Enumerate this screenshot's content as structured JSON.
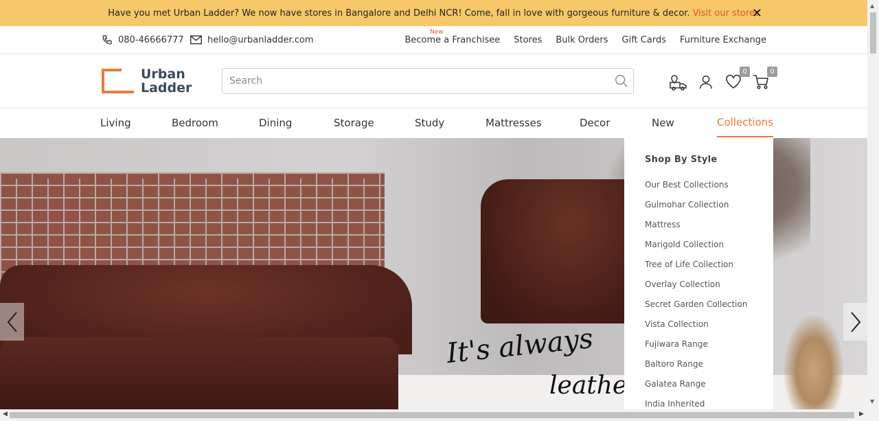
{
  "announcement": {
    "text": "Have you met Urban Ladder? We now have stores in Bangalore and Delhi NCR! Come, fall in love with gorgeous furniture & decor.",
    "link": "Visit our stores",
    "close": "✕"
  },
  "contact": {
    "phone": "080-46666777",
    "email": "hello@urbanladder.com",
    "new_badge": "New",
    "links": [
      "Become a Franchisee",
      "Stores",
      "Bulk Orders",
      "Gift Cards",
      "Furniture Exchange"
    ]
  },
  "header": {
    "logo_line1": "Urban",
    "logo_line2": "Ladder",
    "search_placeholder": "Search",
    "wishlist_count": "0",
    "cart_count": "0"
  },
  "nav": {
    "items": [
      "Living",
      "Bedroom",
      "Dining",
      "Storage",
      "Study",
      "Mattresses",
      "Decor",
      "New",
      "Collections"
    ],
    "active": "Collections"
  },
  "hero": {
    "tagline1": "It's always",
    "tagline2": "leather"
  },
  "dropdown": {
    "heading": "Shop By Style",
    "items": [
      "Our Best Collections",
      "Gulmohar Collection",
      "Mattress",
      "Marigold Collection",
      "Tree of Life Collection",
      "Overlay Collection",
      "Secret Garden Collection",
      "Vista Collection",
      "Fujiwara Range",
      "Baltoro Range",
      "Galatea Range",
      "India Inherited"
    ]
  },
  "colors": {
    "announce_bg": "#f7c86a",
    "accent": "#e87a3b",
    "link_red": "#e0562a"
  }
}
